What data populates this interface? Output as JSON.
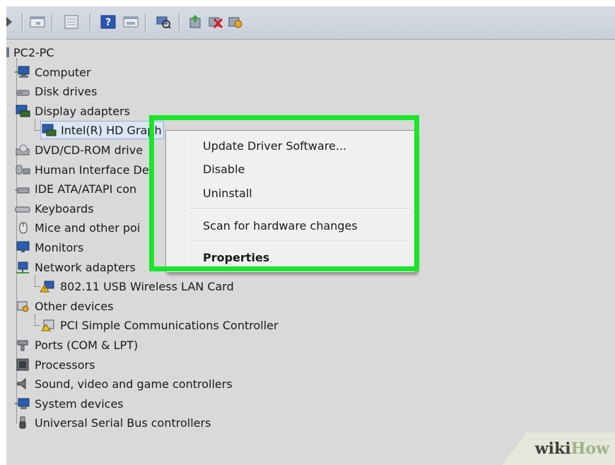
{
  "toolbar": {
    "icons": [
      "forward-arrow-icon",
      "view-icon",
      "window-icon",
      "help-icon",
      "properties-icon",
      "scan-icon",
      "update-driver-icon",
      "uninstall-icon",
      "enable-icon"
    ]
  },
  "tree": {
    "root": "PC2-PC",
    "items": [
      {
        "label": "Computer",
        "icon": "computer-icon"
      },
      {
        "label": "Disk drives",
        "icon": "disk-drive-icon"
      },
      {
        "label": "Display adapters",
        "icon": "display-adapter-icon"
      },
      {
        "label": "Intel(R) HD Graph",
        "icon": "display-adapter-icon",
        "child": true,
        "selected": true
      },
      {
        "label": "DVD/CD-ROM drive",
        "icon": "dvd-drive-icon"
      },
      {
        "label": "Human Interface De",
        "icon": "hid-icon"
      },
      {
        "label": "IDE ATA/ATAPI con",
        "icon": "ide-controller-icon"
      },
      {
        "label": "Keyboards",
        "icon": "keyboard-icon"
      },
      {
        "label": "Mice and other poi",
        "icon": "mouse-icon"
      },
      {
        "label": "Monitors",
        "icon": "monitor-icon"
      },
      {
        "label": "Network adapters",
        "icon": "network-adapter-icon"
      },
      {
        "label": "802.11 USB Wireless LAN Card",
        "icon": "warning-network-icon",
        "child": true
      },
      {
        "label": "Other devices",
        "icon": "unknown-device-icon"
      },
      {
        "label": "PCI Simple Communications Controller",
        "icon": "warning-device-icon",
        "child": true
      },
      {
        "label": "Ports (COM & LPT)",
        "icon": "port-icon"
      },
      {
        "label": "Processors",
        "icon": "processor-icon"
      },
      {
        "label": "Sound, video and game controllers",
        "icon": "sound-icon"
      },
      {
        "label": "System devices",
        "icon": "system-device-icon"
      },
      {
        "label": "Universal Serial Bus controllers",
        "icon": "usb-icon"
      }
    ]
  },
  "context_menu": {
    "update_driver": "Update Driver Software...",
    "disable": "Disable",
    "uninstall": "Uninstall",
    "scan": "Scan for hardware changes",
    "properties": "Properties"
  },
  "highlight_color": "#19e52a",
  "watermark": {
    "part1": "wiki",
    "part2": "How"
  }
}
